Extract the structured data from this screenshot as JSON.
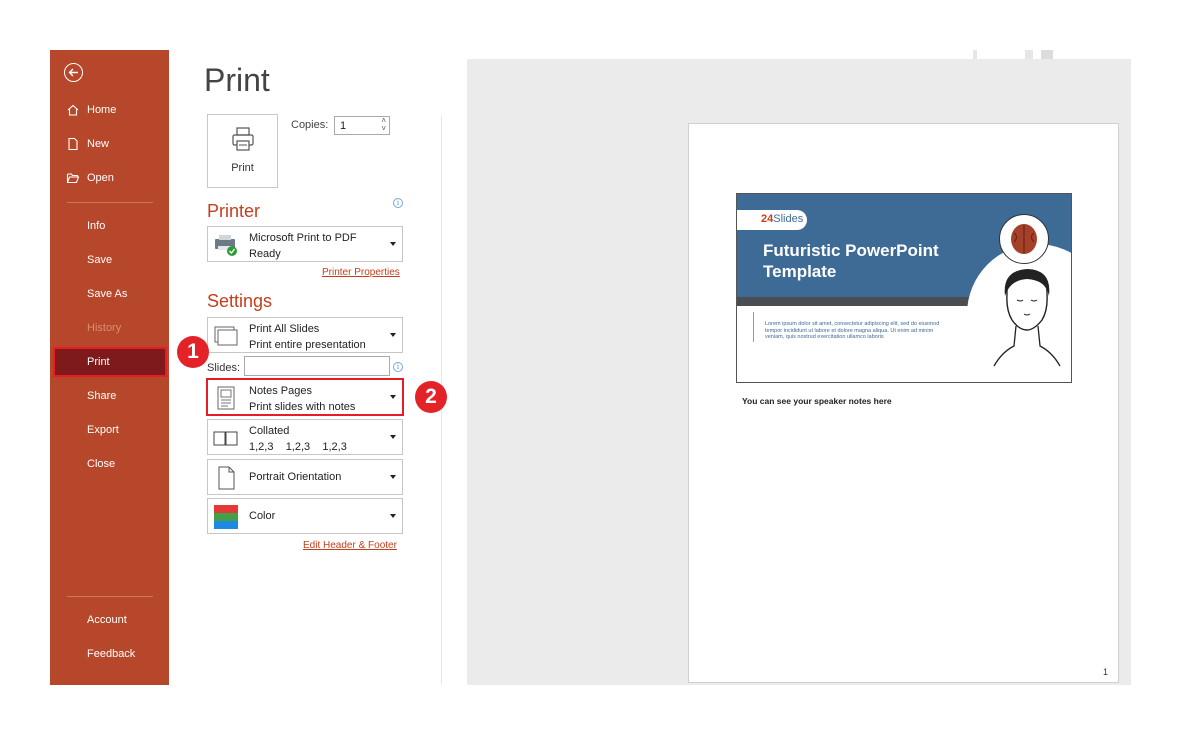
{
  "sidebar": {
    "items": [
      {
        "label": "Home"
      },
      {
        "label": "New"
      },
      {
        "label": "Open"
      },
      {
        "label": "Info"
      },
      {
        "label": "Save"
      },
      {
        "label": "Save As"
      },
      {
        "label": "History"
      },
      {
        "label": "Print"
      },
      {
        "label": "Share"
      },
      {
        "label": "Export"
      },
      {
        "label": "Close"
      },
      {
        "label": "Account"
      },
      {
        "label": "Feedback"
      }
    ]
  },
  "main": {
    "title": "Print",
    "print_button": "Print",
    "copies_label": "Copies:",
    "copies_value": "1",
    "printer_heading": "Printer",
    "printer_name": "Microsoft Print to PDF",
    "printer_status": "Ready",
    "printer_properties": "Printer Properties",
    "settings_heading": "Settings",
    "slides_label": "Slides:",
    "slides_value": "",
    "dropdowns": {
      "range_main": "Print All Slides",
      "range_sub": "Print entire presentation",
      "layout_main": "Notes Pages",
      "layout_sub": "Print slides with notes",
      "collate_main": "Collated",
      "collate_sub": "1,2,3    1,2,3    1,2,3",
      "orientation": "Portrait Orientation",
      "color": "Color"
    },
    "edit_header_footer": "Edit Header & Footer"
  },
  "badges": [
    "1",
    "2"
  ],
  "preview": {
    "slide_logo_prefix": "24",
    "slide_logo_suffix": "Slides",
    "slide_title": "Futuristic PowerPoint Template",
    "slide_body": "Lorem ipsum dolor sit amet, consectetur adipiscing elit, sed do eiusmod tempor incididunt ut labore et dolore magna aliqua. Ut enim ad minim veniam, quis nostrud exercitation ullamco laboris",
    "notes": "You can see your speaker notes here",
    "page_number": "1"
  },
  "colors": {
    "sidebar": "#b7472a",
    "selected": "#7e1a1b",
    "accent": "#c43e1c",
    "highlight": "#e81c24"
  }
}
